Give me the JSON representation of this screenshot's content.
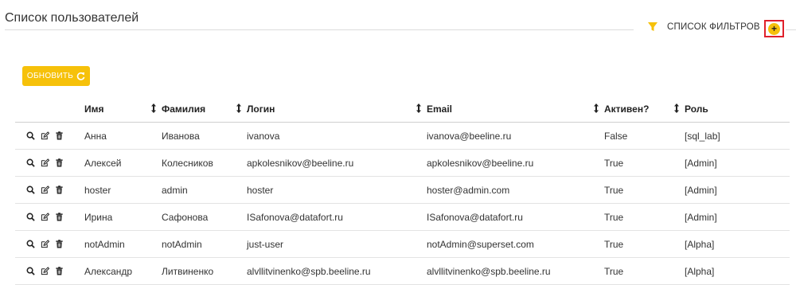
{
  "page": {
    "title": "Список пользователей"
  },
  "filters": {
    "label": "СПИСОК ФИЛЬТРОВ",
    "add_label": "+"
  },
  "toolbar": {
    "refresh_label": "ОБНОВИТЬ"
  },
  "colors": {
    "accent": "#f6c10a",
    "highlight_border": "#e0202b"
  },
  "table": {
    "columns": [
      "Имя",
      "Фамилия",
      "Логин",
      "Email",
      "Активен?",
      "Роль"
    ],
    "rows": [
      {
        "first": "Анна",
        "last": "Иванова",
        "login": "ivanova",
        "email": "ivanova@beeline.ru",
        "active": "False",
        "role": "[sql_lab]"
      },
      {
        "first": "Алексей",
        "last": "Колесников",
        "login": "apkolesnikov@beeline.ru",
        "email": "apkolesnikov@beeline.ru",
        "active": "True",
        "role": "[Admin]"
      },
      {
        "first": "hoster",
        "last": "admin",
        "login": "hoster",
        "email": "hoster@admin.com",
        "active": "True",
        "role": "[Admin]"
      },
      {
        "first": "Ирина",
        "last": "Сафонова",
        "login": "ISafonova@datafort.ru",
        "email": "ISafonova@datafort.ru",
        "active": "True",
        "role": "[Admin]"
      },
      {
        "first": "notAdmin",
        "last": "notAdmin",
        "login": "just-user",
        "email": "notAdmin@superset.com",
        "active": "True",
        "role": "[Alpha]"
      },
      {
        "first": "Александр",
        "last": "Литвиненко",
        "login": "alvllitvinenko@spb.beeline.ru",
        "email": "alvllitvinenko@spb.beeline.ru",
        "active": "True",
        "role": "[Alpha]"
      }
    ]
  }
}
